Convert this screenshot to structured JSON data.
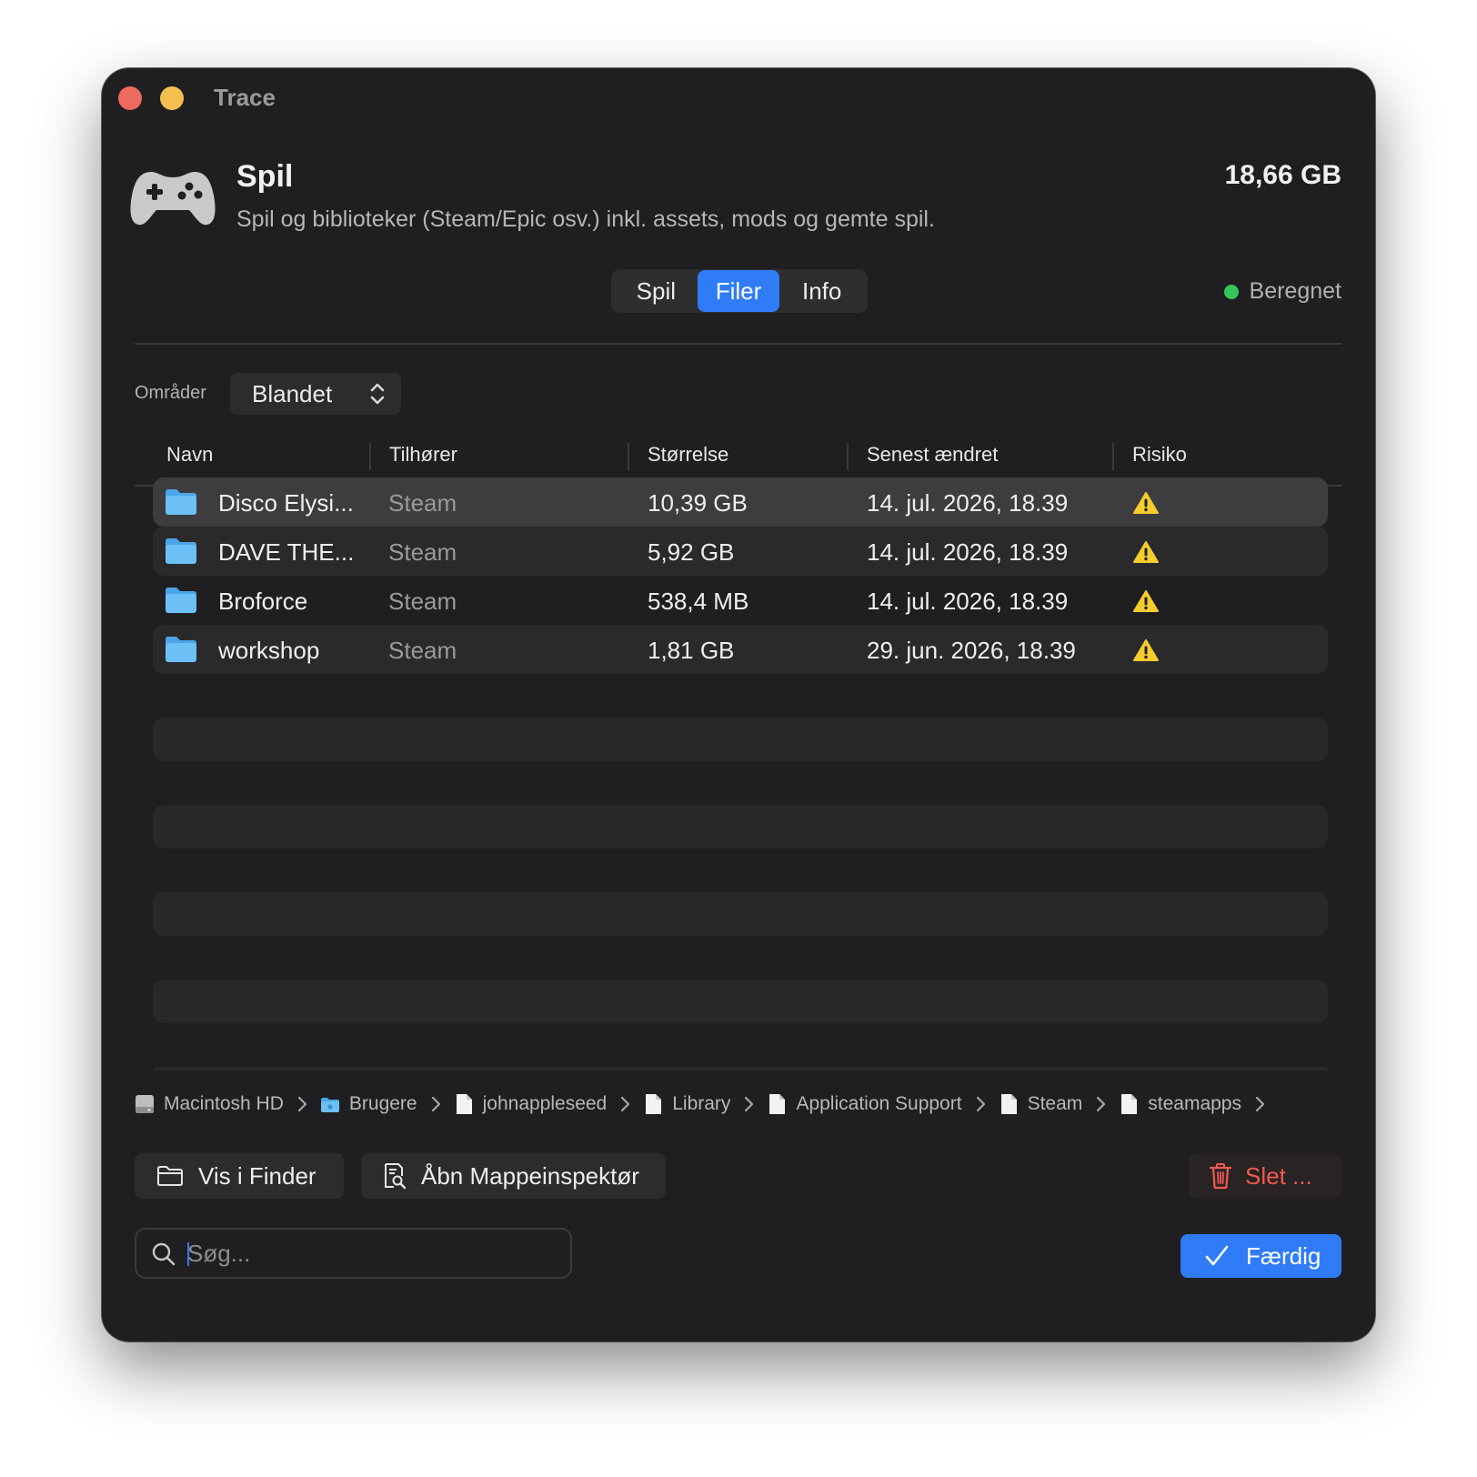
{
  "window": {
    "title": "Trace"
  },
  "category": {
    "title": "Spil",
    "description": "Spil og biblioteker (Steam/Epic osv.) inkl. assets, mods og gemte spil.",
    "size": "18,66 GB",
    "icon": "gamecontroller-icon"
  },
  "tabs": [
    {
      "label": "Spil",
      "selected": false
    },
    {
      "label": "Filer",
      "selected": true
    },
    {
      "label": "Info",
      "selected": false
    }
  ],
  "status": {
    "label": "Beregnet",
    "color": "#34c759"
  },
  "filter": {
    "label": "Områder",
    "value": "Blandet"
  },
  "table": {
    "columns": [
      "Navn",
      "Tilhører",
      "Størrelse",
      "Senest ændret",
      "Risiko"
    ],
    "rows": [
      {
        "name": "Disco Elysi...",
        "owner": "Steam",
        "size": "10,39 GB",
        "modified": "14. jul. 2026, 18.39",
        "risk": "warning-icon",
        "selected": true
      },
      {
        "name": "DAVE THE...",
        "owner": "Steam",
        "size": "5,92 GB",
        "modified": "14. jul. 2026, 18.39",
        "risk": "warning-icon",
        "selected": false
      },
      {
        "name": "Broforce",
        "owner": "Steam",
        "size": "538,4 MB",
        "modified": "14. jul. 2026, 18.39",
        "risk": "warning-icon",
        "selected": false
      },
      {
        "name": "workshop",
        "owner": "Steam",
        "size": "1,81 GB",
        "modified": "29. jun. 2026, 18.39",
        "risk": "warning-icon",
        "selected": false
      }
    ]
  },
  "breadcrumb": [
    {
      "label": "Macintosh HD",
      "icon": "disk-icon"
    },
    {
      "label": "Brugere",
      "icon": "folder-icon"
    },
    {
      "label": "johnappleseed",
      "icon": "document-icon"
    },
    {
      "label": "Library",
      "icon": "document-icon"
    },
    {
      "label": "Application Support",
      "icon": "document-icon"
    },
    {
      "label": "Steam",
      "icon": "document-icon"
    },
    {
      "label": "steamapps",
      "icon": "document-icon"
    }
  ],
  "actions": {
    "show_in_finder": "Vis i Finder",
    "open_inspector": "Åbn Mappeinspektør",
    "delete": "Slet ...",
    "done": "Færdig"
  },
  "search": {
    "placeholder": "Søg...",
    "value": ""
  },
  "colors": {
    "accent": "#2f7cf6",
    "danger": "#ee5a50",
    "warning": "#f5cc2d",
    "folder": "#5fb8f2"
  }
}
